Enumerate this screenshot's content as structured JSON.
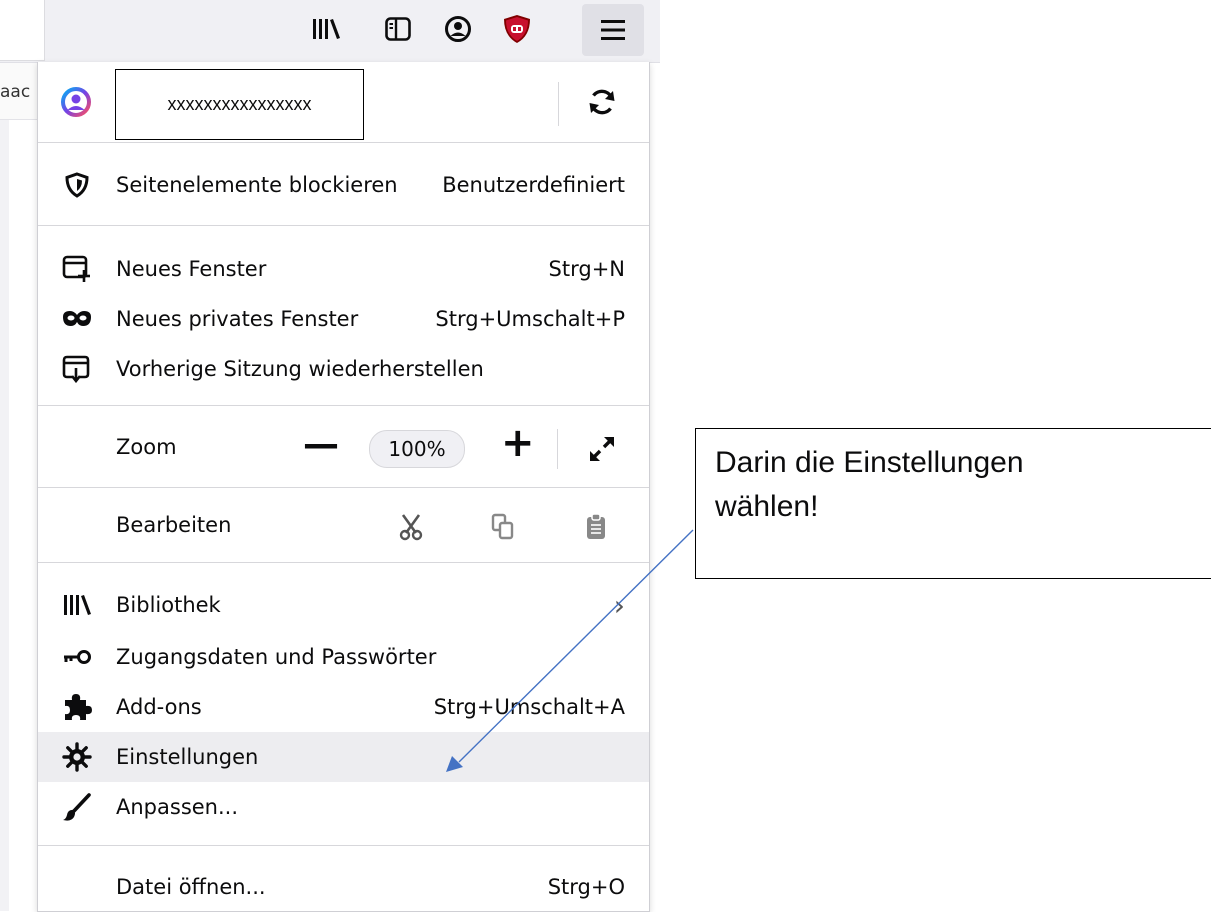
{
  "toolbar": {
    "icons": [
      "library-icon",
      "sidebar-icon",
      "account-icon",
      "ublock-icon",
      "hamburger-menu-icon"
    ]
  },
  "bookmarks": {
    "partial_text": "aac"
  },
  "menu": {
    "account": {
      "email": "xxxxxxxxxxxxxxxx"
    },
    "tracking": {
      "label": "Seitenelemente blockieren",
      "value": "Benutzerdefiniert"
    },
    "new_window": {
      "label": "Neues Fenster",
      "shortcut": "Strg+N"
    },
    "private_window": {
      "label": "Neues privates Fenster",
      "shortcut": "Strg+Umschalt+P"
    },
    "restore_session": {
      "label": "Vorherige Sitzung wiederherstellen"
    },
    "zoom": {
      "label": "Zoom",
      "minus": "—",
      "value": "100%",
      "plus": "+"
    },
    "edit": {
      "label": "Bearbeiten"
    },
    "library": {
      "label": "Bibliothek",
      "chevron": "›"
    },
    "logins": {
      "label": "Zugangsdaten und Passwörter"
    },
    "addons": {
      "label": "Add-ons",
      "shortcut": "Strg+Umschalt+A"
    },
    "settings": {
      "label": "Einstellungen"
    },
    "customize": {
      "label": "Anpassen..."
    },
    "open_file": {
      "label": "Datei öffnen...",
      "shortcut": "Strg+O"
    }
  },
  "annotation": {
    "line1": "Darin die Einstellungen",
    "line2": "wählen!",
    "arrow_color": "#4472c4"
  },
  "colors": {
    "account_accent": "#7542e5",
    "ublock_red": "#800000",
    "highlight": "#ededf0"
  }
}
